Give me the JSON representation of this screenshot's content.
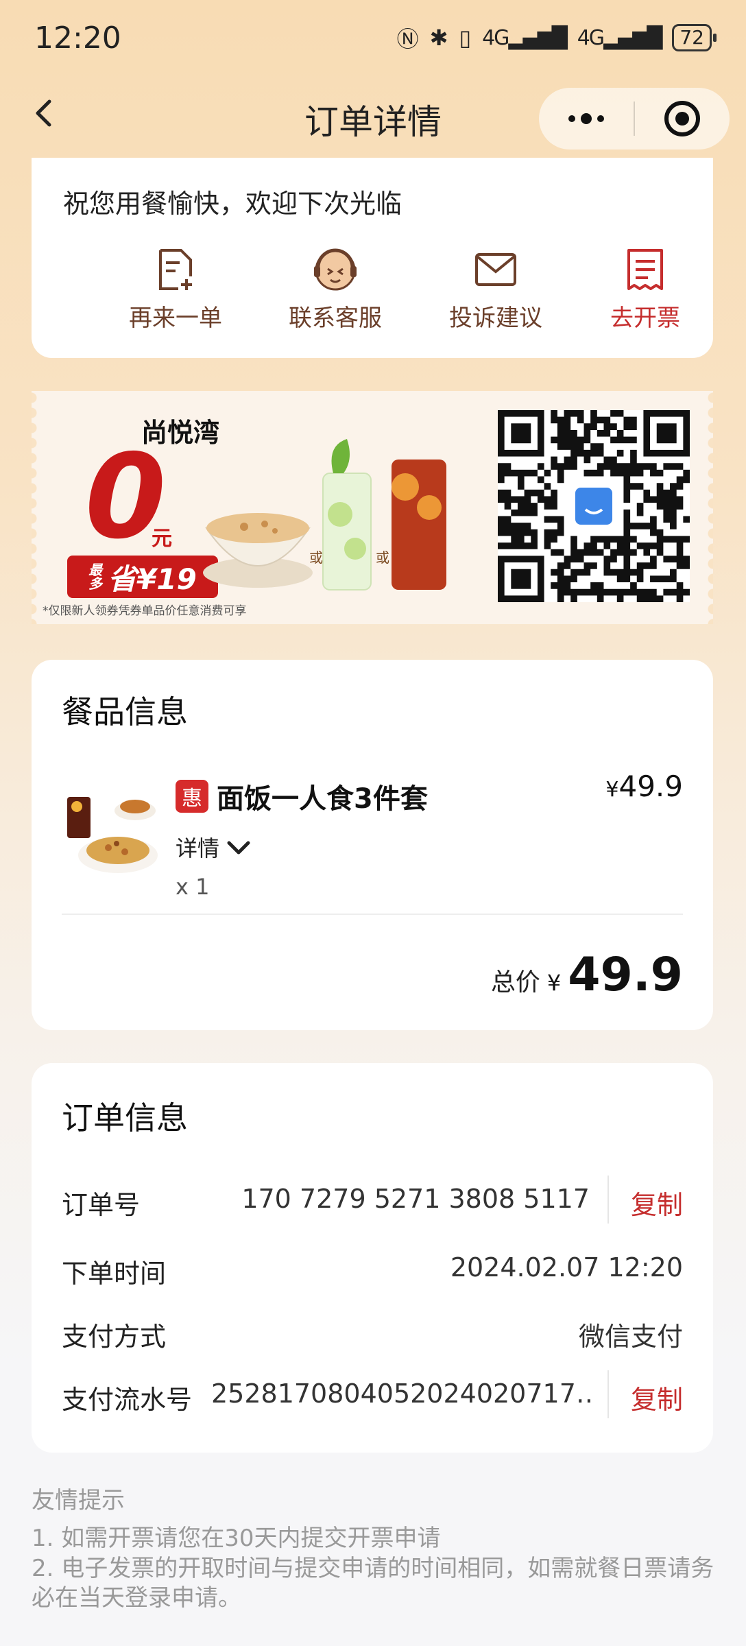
{
  "status_bar": {
    "time": "12:20",
    "signal1": "4G",
    "signal2": "4G",
    "battery": "72"
  },
  "nav": {
    "title": "订单详情"
  },
  "top_card": {
    "greeting": "祝您用餐愉快，欢迎下次光临",
    "actions": [
      {
        "label": "再来一单",
        "icon": "reorder-icon"
      },
      {
        "label": "联系客服",
        "icon": "customer-service-icon"
      },
      {
        "label": "投诉建议",
        "icon": "mail-icon"
      },
      {
        "label": "去开票",
        "icon": "invoice-icon"
      }
    ]
  },
  "banner": {
    "brand": "尚悦湾",
    "price": "0",
    "unit": "元",
    "save_prefix": "最多",
    "save_text": "省¥19",
    "or1": "或",
    "or2": "或",
    "fine_print": "*仅限新人领券凭券单品价任意消费可享"
  },
  "product": {
    "section_title": "餐品信息",
    "tag": "惠",
    "name": "面饭一人食3件套",
    "price_currency": "¥",
    "price": "49.9",
    "detail_label": "详情",
    "qty": "x 1",
    "total_label": "总价",
    "total_currency": "¥",
    "total": "49.9"
  },
  "order": {
    "section_title": "订单信息",
    "order_no_label": "订单号",
    "order_no": "170 7279 5271 3808 5117",
    "copy_label": "复制",
    "time_label": "下单时间",
    "time": "2024.02.07 12:20",
    "pay_label": "支付方式",
    "pay_method": "微信支付",
    "serial_label": "支付流水号",
    "serial": "2528170804052024020717…",
    "copy_label2": "复制"
  },
  "tips": {
    "title": "友情提示",
    "line1": "1. 如需开票请您在30天内提交开票申请",
    "line2": "2. 电子发票的开取时间与提交申请的时间相同，如需就餐日票请务必在当天登录申请。"
  }
}
